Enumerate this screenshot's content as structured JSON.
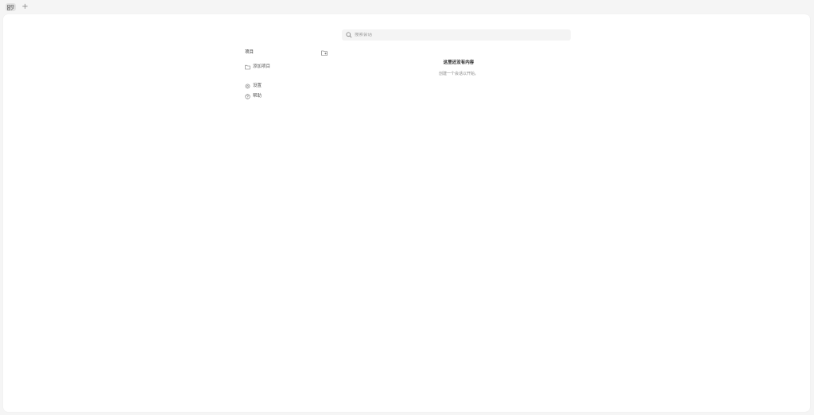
{
  "tabbar": {
    "active_tab_icon": "grid-edit-icon",
    "add_tab_label": "+"
  },
  "search": {
    "placeholder": "搜索会话",
    "value": ""
  },
  "sidebar": {
    "title": "项目",
    "new_folder_icon": "folder-plus-icon",
    "items": [
      {
        "label": "添加项目",
        "icon": "folder-icon"
      },
      {
        "label": "设置",
        "icon": "gear-icon"
      },
      {
        "label": "帮助",
        "icon": "help-circle-icon"
      }
    ]
  },
  "main": {
    "empty_title": "这里还没有内容",
    "empty_subtitle": "创建一个会话以开始。"
  },
  "colors": {
    "background": "#f5f5f5",
    "panel": "#ffffff",
    "search_bg": "#f4f4f4",
    "tab_active_bg": "#e2e2e2"
  }
}
